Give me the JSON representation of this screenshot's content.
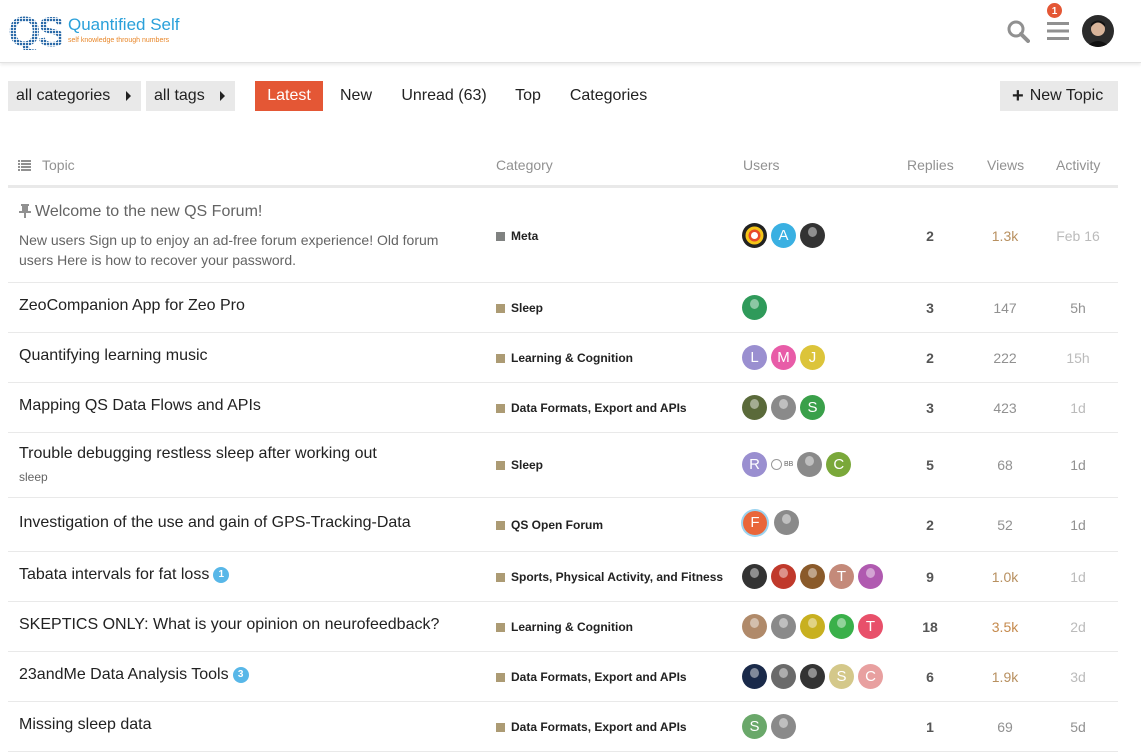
{
  "site": {
    "logo_mark": "QS",
    "logo_title": "Quantified Self",
    "logo_subtitle": "self knowledge through numbers",
    "notification_count": "1"
  },
  "nav": {
    "categories_dropdown": "all categories",
    "tags_dropdown": "all tags",
    "tabs": [
      "Latest",
      "New",
      "Unread (63)",
      "Top",
      "Categories"
    ],
    "active_tab": "Latest",
    "new_topic_label": "New Topic"
  },
  "columns": {
    "topic": "Topic",
    "category": "Category",
    "users": "Users",
    "replies": "Replies",
    "views": "Views",
    "activity": "Activity"
  },
  "colors": {
    "accent": "#e45735",
    "meta_category": "#808281",
    "default_category": "#ac9b74"
  },
  "topics": [
    {
      "title": "Welcome to the new QS Forum!",
      "pinned": true,
      "excerpt": "New users Sign up to enjoy an ad-free forum experience! Old forum users Here is how to recover your password.",
      "category": "Meta",
      "replies": "2",
      "views": "1.3k",
      "activity": "Feb 16"
    },
    {
      "title": "ZeoCompanion App for Zeo Pro",
      "category": "Sleep",
      "replies": "3",
      "views": "147",
      "activity": "5h"
    },
    {
      "title": "Quantifying learning music",
      "category": "Learning & Cognition",
      "replies": "2",
      "views": "222",
      "activity": "15h"
    },
    {
      "title": "Mapping QS Data Flows and APIs",
      "category": "Data Formats, Export and APIs",
      "replies": "3",
      "views": "423",
      "activity": "1d"
    },
    {
      "title": "Trouble debugging restless sleep after working out",
      "tag": "sleep",
      "category": "Sleep",
      "replies": "5",
      "views": "68",
      "activity": "1d"
    },
    {
      "title": "Investigation of the use and gain of GPS-Tracking-Data",
      "category": "QS Open Forum",
      "replies": "2",
      "views": "52",
      "activity": "1d"
    },
    {
      "title": "Tabata intervals for fat loss",
      "unread": "1",
      "category": "Sports, Physical Activity, and Fitness",
      "replies": "9",
      "views": "1.0k",
      "activity": "1d"
    },
    {
      "title": "SKEPTICS ONLY: What is your opinion on neurofeedback?",
      "category": "Learning & Cognition",
      "replies": "18",
      "views": "3.5k",
      "activity": "2d"
    },
    {
      "title": "23andMe Data Analysis Tools",
      "unread": "3",
      "category": "Data Formats, Export and APIs",
      "replies": "6",
      "views": "1.9k",
      "activity": "3d"
    },
    {
      "title": "Missing sleep data",
      "category": "Data Formats, Export and APIs",
      "replies": "1",
      "views": "69",
      "activity": "5d"
    }
  ],
  "avatar_letters": {
    "row0": [
      "",
      "A",
      ""
    ],
    "row2": [
      "L",
      "M",
      "J"
    ],
    "row3": [
      "",
      "",
      "S"
    ],
    "row4": [
      "R",
      "BB",
      "",
      "C"
    ],
    "row5": [
      "F",
      ""
    ],
    "row6": [
      "",
      "",
      "",
      "T",
      ""
    ],
    "row7": [
      "",
      "",
      "",
      "",
      "T"
    ],
    "row8": [
      "",
      "",
      "",
      "S",
      "C"
    ],
    "row9": [
      "S",
      ""
    ]
  }
}
